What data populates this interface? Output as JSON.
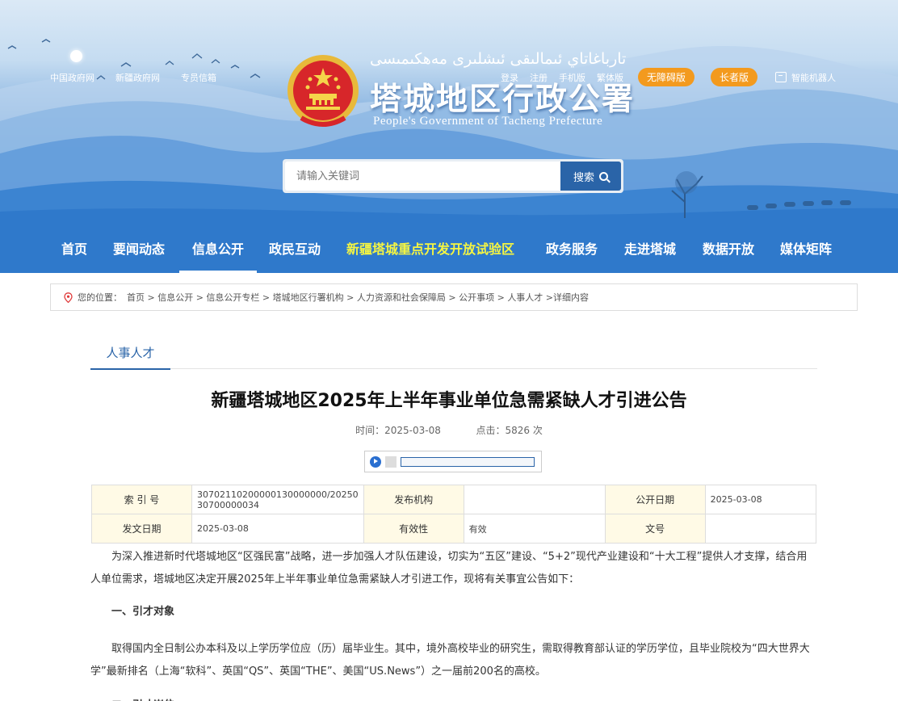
{
  "header": {
    "top_links_left": [
      "中国政府网",
      "新疆政府网",
      "专员信箱"
    ],
    "top_links_right": [
      "登录",
      "注册",
      "手机版",
      "繁体版"
    ],
    "accessibility_label": "无障碍版",
    "elder_label": "长者版",
    "robot_label": "智能机器人",
    "title_uyghur": "تارباغاتاي ئىمالىقى ئىشلىرى مەھكىمىسى",
    "title_cn": "塔城地区行政公署",
    "title_en": "People's Government of Tacheng Prefecture"
  },
  "search": {
    "placeholder": "请输入关键词",
    "button_label": "搜索"
  },
  "nav": {
    "items": [
      "首页",
      "要闻动态",
      "信息公开",
      "政民互动",
      "新疆塔城重点开发开放试验区",
      "政务服务",
      "走进塔城",
      "数据开放",
      "媒体矩阵"
    ]
  },
  "breadcrumb": {
    "prefix": "您的位置：",
    "items": [
      "首页",
      "信息公开",
      "信息公开专栏",
      "塔城地区行署机构",
      "人力资源和社会保障局",
      "公开事项",
      "人事人才",
      "详细内容"
    ]
  },
  "section_tab": "人事人才",
  "article": {
    "title": "新疆塔城地区2025年上半年事业单位急需紧缺人才引进公告",
    "time_label": "时间：",
    "time_value": "2025-03-08",
    "clicks_label": "点击：",
    "clicks_value": "5826 次"
  },
  "info_table": {
    "index_label": "索 引 号",
    "index_value_line1": "30702110200000130000000/20250",
    "index_value_line2": "30700000034",
    "publisher_label": "发布机构",
    "publisher_value": "",
    "public_date_label": "公开日期",
    "public_date_value": "2025-03-08",
    "issue_date_label": "发文日期",
    "issue_date_value": "2025-03-08",
    "validity_label": "有效性",
    "validity_value": "有效",
    "doc_no_label": "文号",
    "doc_no_value": ""
  },
  "body": {
    "para1": "为深入推进新时代塔城地区“区强民富”战略，进一步加强人才队伍建设，切实为“五区”建设、“5+2”现代产业建设和“十大工程”提供人才支撑，结合用人单位需求，塔城地区决定开展2025年上半年事业单位急需紧缺人才引进工作，现将有关事宜公告如下：",
    "heading1": "一、引才对象",
    "para2": "取得国内全日制公办本科及以上学历学位应（历）届毕业生。其中，境外高校毕业的研究生，需取得教育部认证的学历学位，且毕业院校为“四大世界大学”最新排名（上海“软科”、英国“QS”、英国“THE”、美国“US.News”）之一届前200名的高校。",
    "heading2": "二、引才岗位"
  },
  "colors": {
    "primary_blue": "#2a64a8",
    "accent_orange": "#f39a1e",
    "nav_highlight": "#f5f542"
  }
}
